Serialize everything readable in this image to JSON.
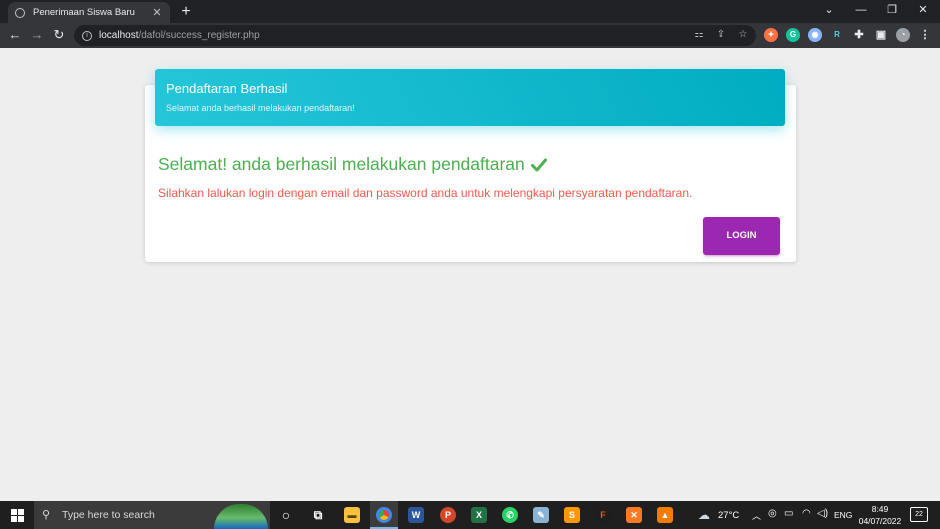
{
  "browser": {
    "tab_title": "Penerimaan Siswa Baru",
    "tab_close": "✕",
    "new_tab": "+",
    "url_host": "localhost",
    "url_path": "/dafol/success_register.php",
    "back": "←",
    "forward": "→",
    "reload": "↻",
    "window_controls": [
      "⌄",
      "—",
      "❐",
      "✕"
    ]
  },
  "card": {
    "title": "Pendaftaran Berhasil",
    "category": "Selamat anda berhasil melakukan pendaftaran!",
    "success_message": "Selamat! anda berhasil melakukan pendaftaran",
    "info_message": "Silahkan lalukan login dengan email dan password anda untuk melengkapi persyaratan pendaftaran.",
    "login_label": "LOGIN"
  },
  "taskbar": {
    "search_placeholder": "Type here to search",
    "weather": "27°C",
    "language": "ENG",
    "time": "8:49",
    "date": "04/07/2022",
    "notifications": "22"
  },
  "colors": {
    "header_start": "#26c6da",
    "header_end": "#00acc1",
    "success": "#4caf50",
    "danger": "#f44336",
    "button": "#9c27b0"
  }
}
